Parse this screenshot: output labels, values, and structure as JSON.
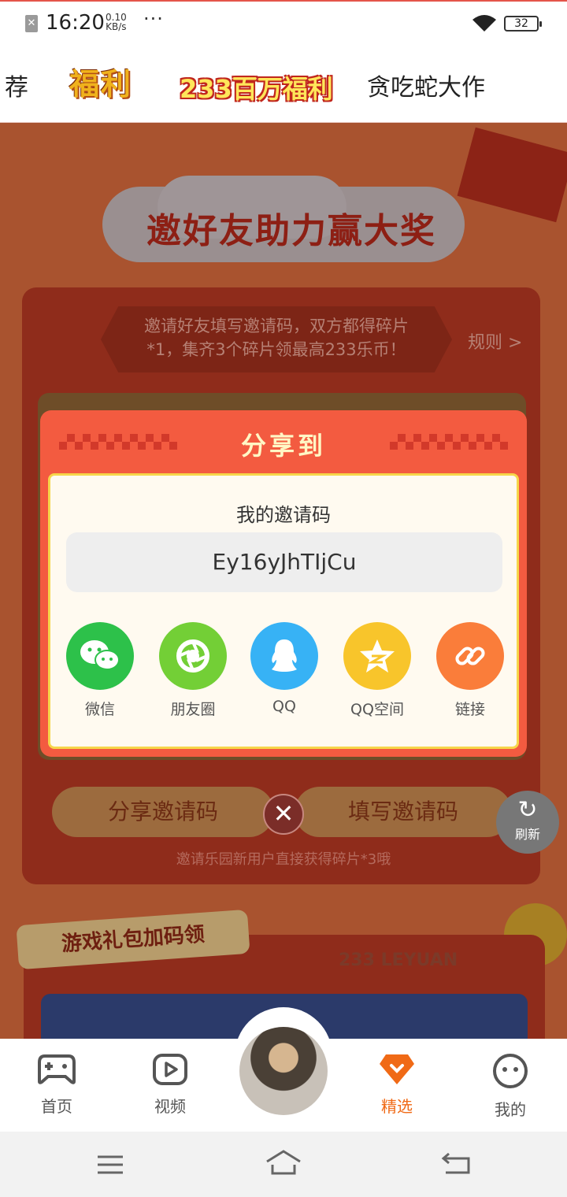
{
  "status_bar": {
    "time": "16:20",
    "net_speed": "0.10",
    "net_unit": "KB/s",
    "dots": "···",
    "battery": "32"
  },
  "top_tabs": [
    {
      "label": "荐"
    },
    {
      "label": "福利"
    },
    {
      "label": "233百万福利"
    },
    {
      "label": "贪吃蛇大作"
    }
  ],
  "activity": {
    "banner_title": "邀好友助力赢大奖",
    "notice_line1": "邀请好友填写邀请码，双方都得碎片",
    "notice_line2": "*1，集齐3个碎片领最高233乐币！",
    "rules_label": "规则 >",
    "share_code_button": "分享邀请码",
    "fill_code_button": "填写邀请码",
    "hint": "邀请乐园新用户直接获得碎片*3哦",
    "gift_section_title": "游戏礼包加码领",
    "brand_text": "233 LEYUAN"
  },
  "refresh": {
    "label": "刷新",
    "icon": "refresh-icon"
  },
  "share_dialog": {
    "title": "分享到",
    "code_label": "我的邀请码",
    "invite_code": "Ey16yJhTIjCu",
    "targets": [
      {
        "label": "微信",
        "icon": "wechat-icon",
        "color": "#2dc14a"
      },
      {
        "label": "朋友圈",
        "icon": "moments-icon",
        "color": "#73cf36"
      },
      {
        "label": "QQ",
        "icon": "qq-icon",
        "color": "#37b2f5"
      },
      {
        "label": "QQ空间",
        "icon": "qzone-icon",
        "color": "#f8c52b"
      },
      {
        "label": "链接",
        "icon": "link-icon",
        "color": "#fa7d3a"
      }
    ],
    "close_icon": "close-icon"
  },
  "bottom_nav": [
    {
      "label": "首页",
      "icon": "gamepad-icon"
    },
    {
      "label": "视频",
      "icon": "play-icon"
    },
    {
      "label": "精选",
      "icon": "featured-icon",
      "active": true
    },
    {
      "label": "我的",
      "icon": "smiley-icon"
    }
  ],
  "colors": {
    "accent_orange": "#f06a16",
    "dialog_red": "#f35b40"
  }
}
